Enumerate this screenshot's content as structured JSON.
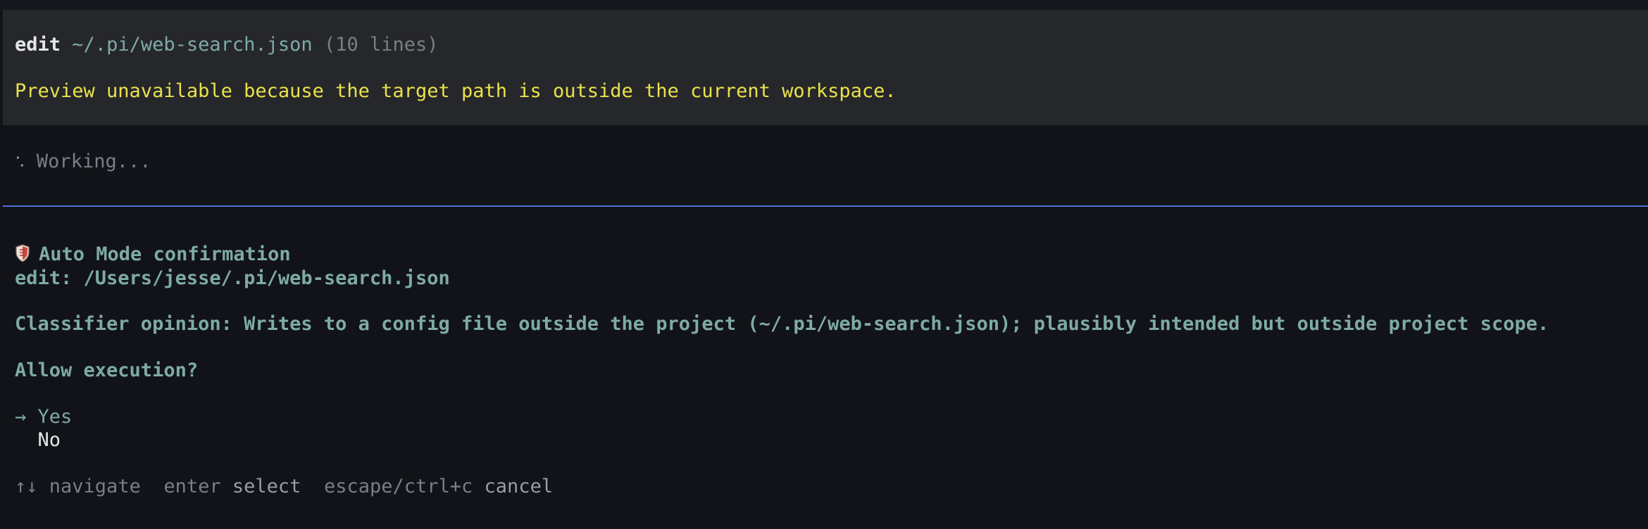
{
  "tool_call": {
    "command": "edit",
    "path": "~/.pi/web-search.json",
    "line_count": "(10 lines)",
    "warning": "Preview unavailable because the target path is outside the current workspace."
  },
  "status": {
    "spinner": "⠡",
    "text": "Working..."
  },
  "confirmation": {
    "icon": "shield-icon",
    "title": "Auto Mode confirmation",
    "action": "edit: /Users/jesse/.pi/web-search.json",
    "classifier_opinion": "Classifier opinion: Writes to a config file outside the project (~/.pi/web-search.json); plausibly intended but outside project scope.",
    "question": "Allow execution?",
    "selected_marker": "→",
    "options": [
      "Yes",
      "No"
    ]
  },
  "hints": {
    "navigate_keys": "↑↓",
    "navigate_label": "navigate",
    "select_key": "enter",
    "select_label": "select",
    "cancel_key": "escape/ctrl+c",
    "cancel_label": "cancel"
  },
  "colors": {
    "background": "#111318",
    "tool_block": "#26272b",
    "accent_teal": "#7eaaa7",
    "warning_yellow": "#e9e24a",
    "divider_blue": "#4f6ed8"
  }
}
